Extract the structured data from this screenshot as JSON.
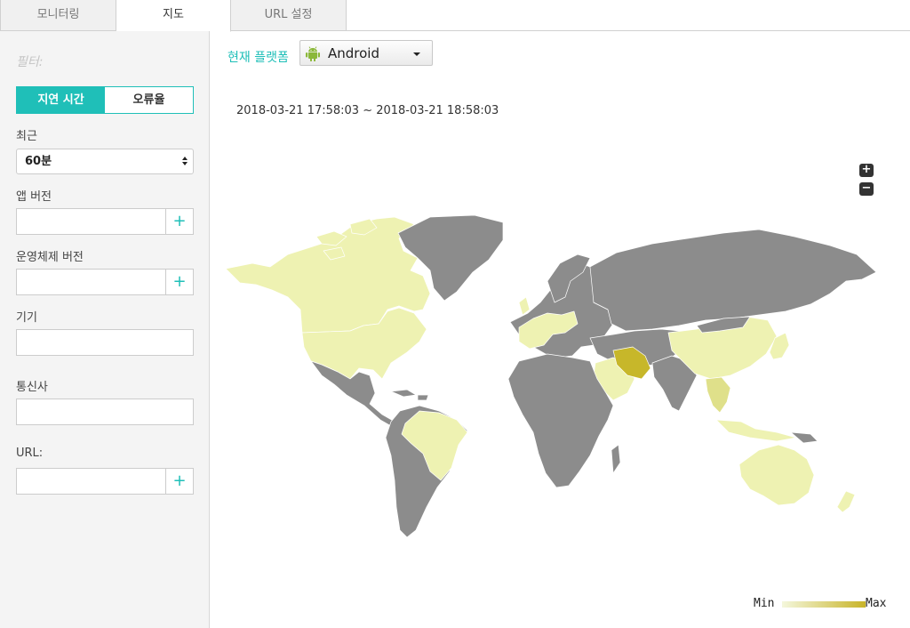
{
  "tabs": [
    {
      "label": "모니터링"
    },
    {
      "label": "지도"
    },
    {
      "label": "URL 설정"
    }
  ],
  "sidebar": {
    "filter_title": "필터:",
    "segment": {
      "active": "지연 시간",
      "inactive": "오류율"
    },
    "recent_label": "최근",
    "recent_value": "60분",
    "app_version_label": "앱 버전",
    "os_version_label": "운영체제 버전",
    "device_label": "기기",
    "carrier_label": "통신사",
    "url_label": "URL:",
    "plus": "+"
  },
  "main": {
    "platform_label": "현재 플랫폼",
    "platform_value": "Android",
    "time_range": "2018-03-21 17:58:03 ~ 2018-03-21 18:58:03",
    "zoom_in": "+",
    "zoom_out": "−"
  },
  "legend": {
    "min": "Min",
    "max": "Max"
  },
  "colors": {
    "accent": "#1fbfb8",
    "no_data": "#8c8c8c",
    "low": "#eef2b2",
    "mid": "#dfe08a",
    "high": "#c7b72a"
  },
  "map_regions": [
    {
      "name": "Iran",
      "level": "high"
    },
    {
      "name": "Saudi Arabia",
      "level": "low"
    },
    {
      "name": "Canada",
      "level": "low"
    },
    {
      "name": "United States",
      "level": "low"
    },
    {
      "name": "Brazil",
      "level": "low"
    },
    {
      "name": "China",
      "level": "low"
    },
    {
      "name": "Australia",
      "level": "low"
    },
    {
      "name": "New Zealand",
      "level": "low"
    },
    {
      "name": "Japan",
      "level": "low"
    },
    {
      "name": "Western Europe",
      "level": "low"
    },
    {
      "name": "Southeast Asia",
      "level": "mid"
    }
  ]
}
